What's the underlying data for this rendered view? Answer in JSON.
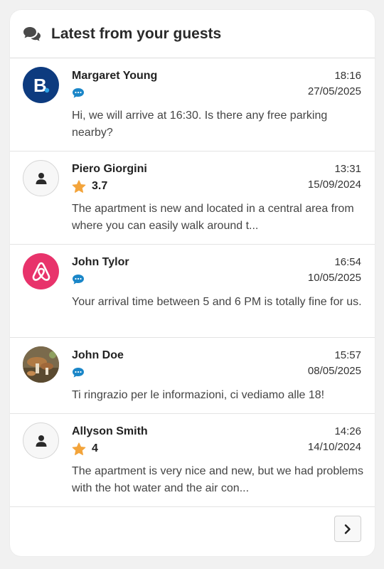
{
  "header": {
    "title": "Latest from your guests",
    "icon": "chat-bubbles-icon"
  },
  "colors": {
    "accent_blue": "#1a86c8",
    "star": "#f3a43b",
    "booking": "#0d3b7f",
    "airbnb": "#e8336b"
  },
  "messages": [
    {
      "name": "Margaret Young",
      "source": "booking-logo",
      "indicator": "message-icon",
      "time": "18:16",
      "date": "27/05/2025",
      "preview": "Hi, we will arrive at 16:30. Is there any free parking nearby?"
    },
    {
      "name": "Piero Giorgini",
      "source": "user-icon",
      "indicator": "star-icon",
      "rating": "3.7",
      "time": "13:31",
      "date": "15/09/2024",
      "preview": "The apartment is new and located in a central area from where you can easily walk around t..."
    },
    {
      "name": "John Tylor",
      "source": "airbnb-logo",
      "indicator": "message-icon",
      "time": "16:54",
      "date": "10/05/2025",
      "preview": "Your arrival time between 5 and 6 PM is totally fine for us."
    },
    {
      "name": "John Doe",
      "source": "photo-avatar",
      "indicator": "message-icon",
      "time": "15:57",
      "date": "08/05/2025",
      "preview": "Ti ringrazio per le informazioni, ci vediamo alle 18!"
    },
    {
      "name": "Allyson Smith",
      "source": "user-icon",
      "indicator": "star-icon",
      "rating": "4",
      "time": "14:26",
      "date": "14/10/2024",
      "preview": "The apartment is very nice and new, but we had problems with the hot water and the air con..."
    }
  ],
  "footer": {
    "next_icon": "chevron-right-icon"
  }
}
